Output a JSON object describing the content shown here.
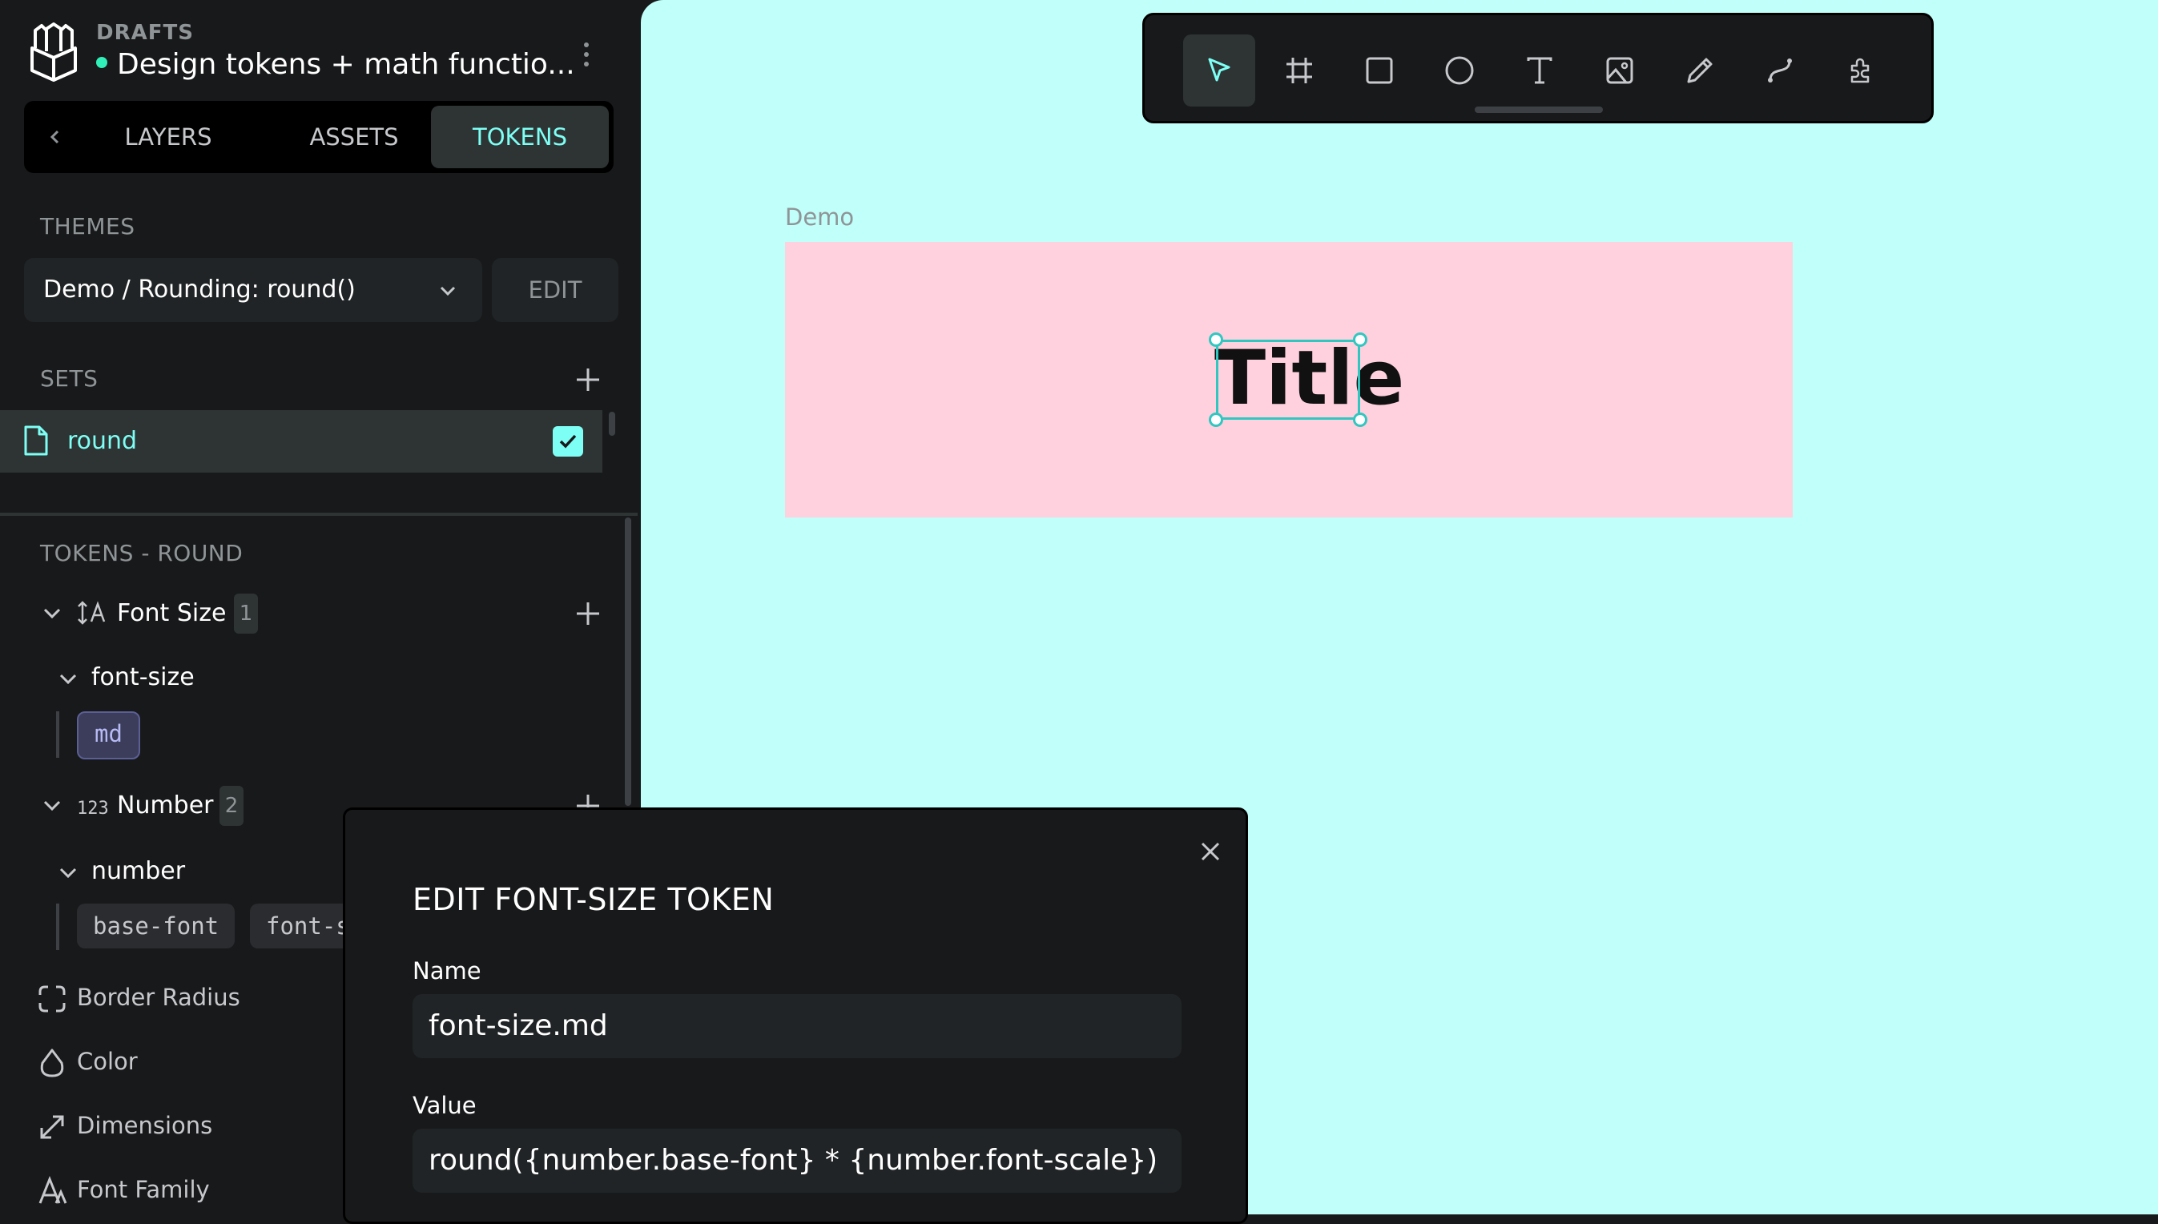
{
  "header": {
    "section": "DRAFTS",
    "file_title": "Design tokens + math functio..."
  },
  "tabs": {
    "back_icon": "chevron-left-icon",
    "items": [
      {
        "label": "LAYERS",
        "active": false
      },
      {
        "label": "ASSETS",
        "active": false
      },
      {
        "label": "TOKENS",
        "active": true
      }
    ]
  },
  "themes": {
    "title": "THEMES",
    "selected": "Demo / Rounding: round()",
    "edit_label": "EDIT"
  },
  "sets": {
    "title": "SETS",
    "items": [
      {
        "label": "round",
        "checked": true
      }
    ]
  },
  "tokens": {
    "title": "TOKENS - ROUND",
    "groups": [
      {
        "label": "Font Size",
        "count": "1",
        "subgroup": "font-size",
        "tokens": [
          "md"
        ]
      },
      {
        "label": "Number",
        "count": "2",
        "subgroup": "number",
        "tokens": [
          "base-font",
          "font-scale"
        ]
      }
    ],
    "categories": [
      "Border Radius",
      "Color",
      "Dimensions",
      "Font Family"
    ]
  },
  "toolbar": {
    "tools": [
      "pointer-icon",
      "board-icon",
      "rectangle-icon",
      "ellipse-icon",
      "text-icon",
      "image-icon",
      "pencil-icon",
      "path-icon",
      "plugin-icon"
    ],
    "active": "pointer-icon"
  },
  "canvas": {
    "board_name": "Demo",
    "text_layer": "Title",
    "background": "#c0fffa",
    "board_color": "#ffd1df",
    "selection_color": "#31c7c0"
  },
  "modal": {
    "title": "EDIT FONT-SIZE TOKEN",
    "name_label": "Name",
    "name_value": "font-size.md",
    "value_label": "Value",
    "value_value": "round({number.base-font} * {number.font-scale})"
  },
  "colors": {
    "accent": "#7efff5",
    "status_dot": "#31efb8",
    "panel": "#18191b"
  }
}
